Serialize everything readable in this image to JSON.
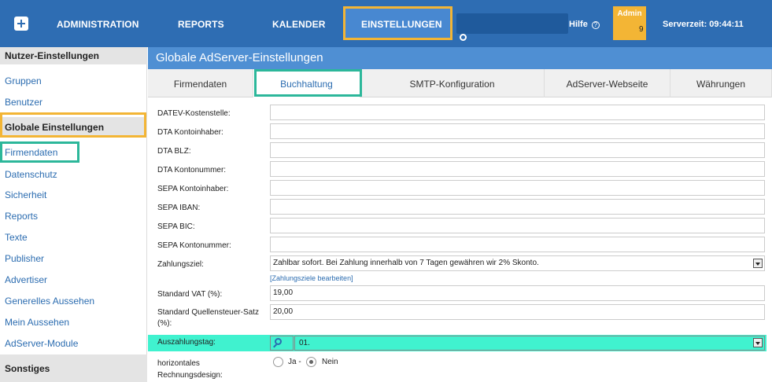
{
  "topbar": {
    "nav": [
      "ADMINISTRATION",
      "REPORTS",
      "KALENDER",
      "EINSTELLUNGEN"
    ],
    "help": "Hilfe",
    "help_icon": "?",
    "admin_badge": "Admin",
    "admin_count": "9",
    "server_time": "Serverzeit: 09:44:11"
  },
  "sidebar": {
    "section1": "Nutzer-Einstellungen",
    "section1_items": [
      "Gruppen",
      "Benutzer"
    ],
    "section2": "Globale Einstellungen",
    "section2_items": [
      "Firmendaten",
      "Datenschutz",
      "Sicherheit",
      "Reports",
      "Texte",
      "Publisher",
      "Advertiser",
      "Generelles Aussehen",
      "Mein Aussehen",
      "AdServer-Module"
    ],
    "section3": "Sonstiges"
  },
  "main": {
    "title": "Globale AdServer-Einstellungen",
    "tabs": [
      "Firmendaten",
      "Buchhaltung",
      "SMTP-Konfiguration",
      "AdServer-Webseite",
      "Währungen"
    ],
    "fields": [
      {
        "label": "DATEV-Kostenstelle:",
        "value": ""
      },
      {
        "label": "DTA Kontoinhaber:",
        "value": ""
      },
      {
        "label": "DTA BLZ:",
        "value": ""
      },
      {
        "label": "DTA Kontonummer:",
        "value": ""
      },
      {
        "label": "SEPA Kontoinhaber:",
        "value": ""
      },
      {
        "label": "SEPA IBAN:",
        "value": ""
      },
      {
        "label": "SEPA BIC:",
        "value": ""
      },
      {
        "label": "SEPA Kontonummer:",
        "value": ""
      }
    ],
    "zahlungsziel_label": "Zahlungsziel:",
    "zahlungsziel_value": "Zahlbar sofort. Bei Zahlung innerhalb von 7 Tagen gewähren wir 2% Skonto.",
    "zahlungsziel_edit": "[Zahlungsziele bearbeiten]",
    "vat_label": "Standard VAT (%):",
    "vat_value": "19,00",
    "quellen_label_1": "Standard Quellensteuer-Satz",
    "quellen_label_2": "(%):",
    "quellen_value": "20,00",
    "auszahlung_label": "Auszahlungstag:",
    "auszahlung_value": "01.",
    "design_label_1": "horizontales",
    "design_label_2": "Rechnungsdesign:",
    "radio_ja": "Ja -",
    "radio_nein": "Nein",
    "radio_selected": "Nein"
  },
  "colors": {
    "topbar": "#2e6db3",
    "title_bar": "#4f8fd3",
    "highlight_orange": "#f3b535",
    "highlight_teal": "#2cb79a",
    "row_highlight": "#40f2cf"
  }
}
